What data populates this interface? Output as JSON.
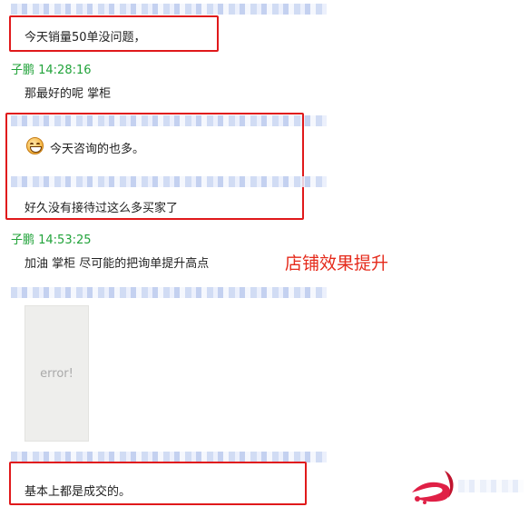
{
  "messages": [
    {
      "text": "今天销量50单没问题，"
    },
    {
      "sender": "子鹏 14:28:16",
      "text": "那最好的呢 掌柜"
    },
    {
      "text": "今天咨询的也多。"
    },
    {
      "text": "好久没有接待过这么多买家了"
    },
    {
      "sender": "子鹏 14:53:25",
      "text": "加油 掌柜 尽可能的把询单提升高点"
    },
    {
      "image_placeholder": "error!"
    },
    {
      "text": "基本上都是成交的。"
    }
  ],
  "annotation": "店铺效果提升",
  "icons": {
    "emoji": "grinning-face-icon",
    "logo": "red-swoosh-logo-icon"
  },
  "colors": {
    "highlight_border": "#e0191b",
    "sender": "#21a33a",
    "annotation": "#e52a1b"
  }
}
